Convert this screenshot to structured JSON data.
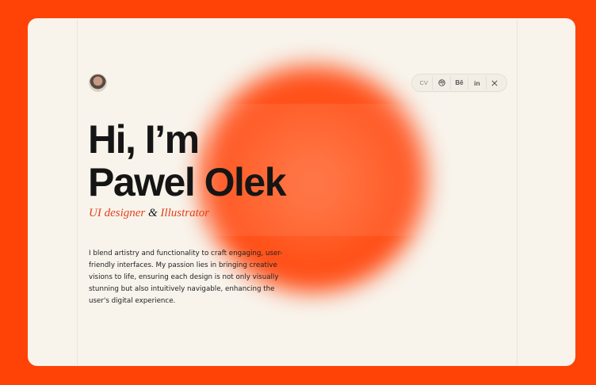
{
  "colors": {
    "background": "#ff4306",
    "card": "#f8f4ec",
    "accent": "#e3401a",
    "text": "#151515"
  },
  "header": {
    "avatar_icon": "profile-photo",
    "social": {
      "cv": "CV",
      "dribbble_icon": "dribbble-icon",
      "behance": "Bē",
      "linkedin": "in",
      "x_icon": "x-icon"
    }
  },
  "hero": {
    "line1": "Hi, I’m",
    "line2": "Pawel Olek",
    "role1": "UI designer",
    "amp": "&",
    "role2": "Illustrator",
    "bio": "I blend artistry and functionality to craft engaging, user-friendly interfaces. My passion lies in bringing creative visions to life, ensuring each design is not only visually stunning but also intuitively navigable, enhancing the user's digital experience."
  }
}
